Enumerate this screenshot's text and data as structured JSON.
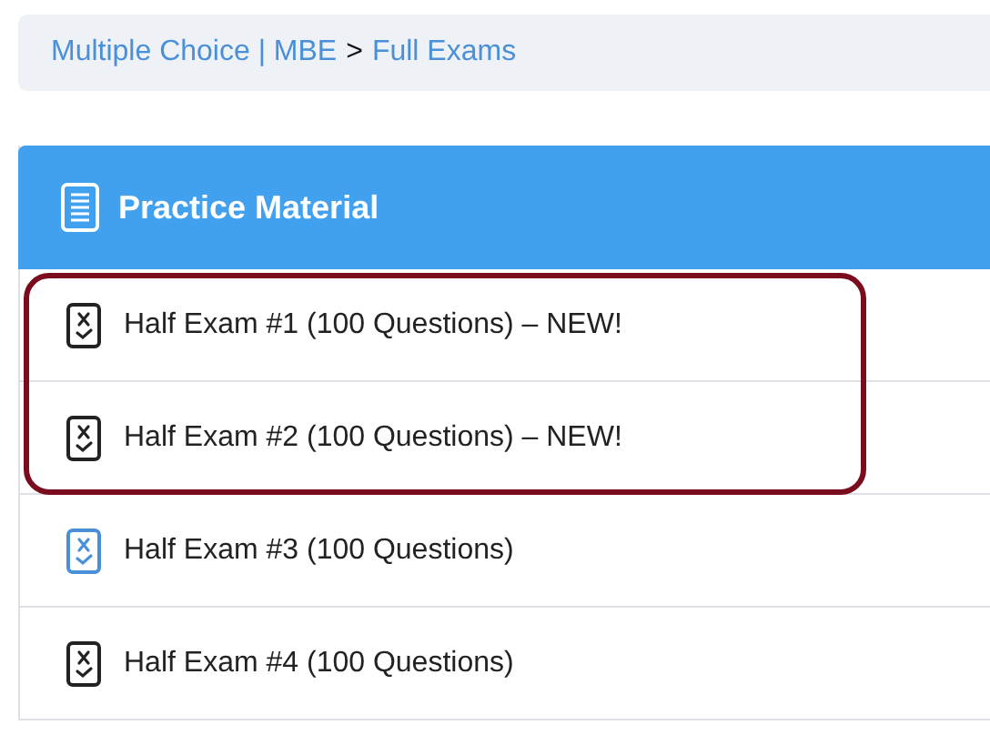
{
  "breadcrumb": [
    {
      "label": "Multiple Choice | MBE",
      "kind": "link"
    },
    {
      "label": ">",
      "kind": "separator"
    },
    {
      "label": "Full Exams",
      "kind": "link"
    }
  ],
  "panel": {
    "title": "Practice Material",
    "items": [
      {
        "label": "Half Exam #1 (100 Questions) – NEW!",
        "color": "#222222",
        "circled": true
      },
      {
        "label": "Half Exam #2 (100 Questions) – NEW!",
        "color": "#222222",
        "circled": true
      },
      {
        "label": "Half Exam #3 (100 Questions)",
        "color": "#4a90d9",
        "circled": false
      },
      {
        "label": "Half Exam #4 (100 Questions)",
        "color": "#222222",
        "circled": false
      }
    ]
  }
}
